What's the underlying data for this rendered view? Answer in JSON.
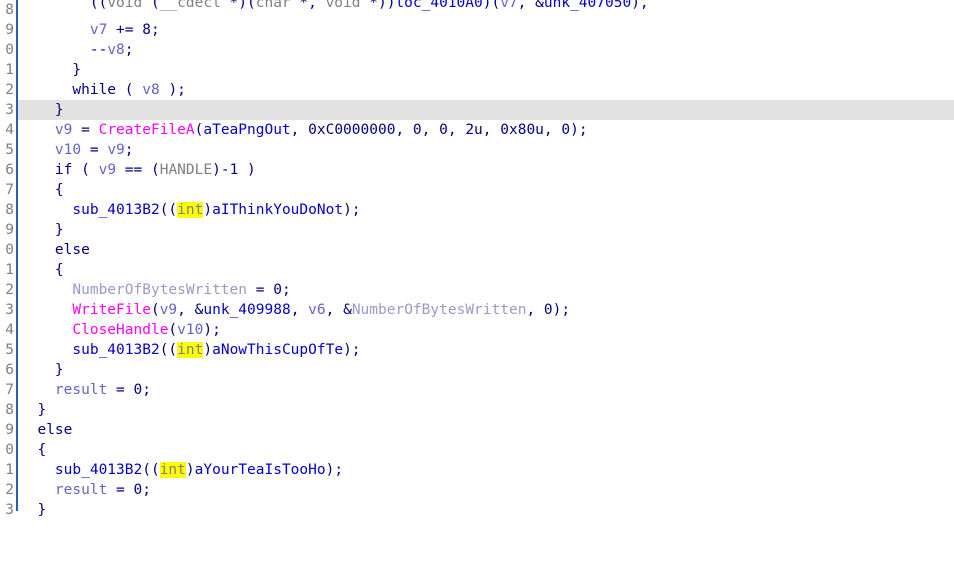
{
  "app": {
    "name": "IDA Pro Hex-Rays Pseudocode",
    "view": "Pseudocode-A"
  },
  "theme": {
    "background": "#ffffff",
    "gutter_border": "#2a5db0",
    "lineno_color": "#808080",
    "highlight_row": "#e2e2e2",
    "selection_highlight": "#ffff00",
    "plain": "#000080",
    "variable": "#6464c8",
    "library_function": "#ff00ff",
    "subroutine": "#0000cd",
    "type_name": "#808080",
    "dim_name": "#9a9ac8"
  },
  "editor": {
    "highlighted_line_index": 5,
    "selected_token": "int",
    "line_numbers": [
      "8",
      "9",
      "0",
      "1",
      "2",
      "3",
      "4",
      "5",
      "6",
      "7",
      "8",
      "9",
      "0",
      "1",
      "2",
      "3",
      "4",
      "5",
      "6",
      "7",
      "8",
      "9",
      "0",
      "1",
      "2",
      "3"
    ]
  },
  "code": {
    "lines": [
      {
        "n": "8",
        "text": "        ((void (__cdecl *)(char *, void *))loc_4010A0)(v7, &unk_407050),"
      },
      {
        "n": "9",
        "text": "        v7 += 8;"
      },
      {
        "n": "0",
        "text": "        --v8;"
      },
      {
        "n": "1",
        "text": "      }"
      },
      {
        "n": "2",
        "text": "      while ( v8 );"
      },
      {
        "n": "3",
        "text": "    }"
      },
      {
        "n": "4",
        "text": "    v9 = CreateFileA(aTeaPngOut, 0xC0000000, 0, 0, 2u, 0x80u, 0);"
      },
      {
        "n": "5",
        "text": "    v10 = v9;"
      },
      {
        "n": "6",
        "text": "    if ( v9 == (HANDLE)-1 )"
      },
      {
        "n": "7",
        "text": "    {"
      },
      {
        "n": "8",
        "text": "      sub_4013B2((int)aIThinkYouDoNot);"
      },
      {
        "n": "9",
        "text": "    }"
      },
      {
        "n": "0",
        "text": "    else"
      },
      {
        "n": "1",
        "text": "    {"
      },
      {
        "n": "2",
        "text": "      NumberOfBytesWritten = 0;"
      },
      {
        "n": "3",
        "text": "      WriteFile(v9, &unk_409988, v6, &NumberOfBytesWritten, 0);"
      },
      {
        "n": "4",
        "text": "      CloseHandle(v10);"
      },
      {
        "n": "5",
        "text": "      sub_4013B2((int)aNowThisCupOfTe);"
      },
      {
        "n": "6",
        "text": "    }"
      },
      {
        "n": "7",
        "text": "    result = 0;"
      },
      {
        "n": "8",
        "text": "  }"
      },
      {
        "n": "9",
        "text": "  else"
      },
      {
        "n": "0",
        "text": "  {"
      },
      {
        "n": "1",
        "text": "    sub_4013B2((int)aYourTeaIsTooHo);"
      },
      {
        "n": "2",
        "text": "    result = 0;"
      },
      {
        "n": "3",
        "text": "  }"
      }
    ],
    "identifiers": {
      "called_subroutines": [
        "loc_4010A0",
        "sub_4013B2"
      ],
      "api_functions": [
        "CreateFileA",
        "WriteFile",
        "CloseHandle"
      ],
      "string_refs": [
        "aTeaPngOut",
        "aIThinkYouDoNot",
        "aNowThisCupOfTe",
        "aYourTeaIsTooHo"
      ],
      "data_refs": [
        "unk_407050",
        "unk_409988"
      ],
      "locals": [
        "v6",
        "v7",
        "v8",
        "v9",
        "v10",
        "result",
        "NumberOfBytesWritten"
      ],
      "constants": [
        "0xC0000000",
        "2u",
        "0x80u",
        "0",
        "8",
        "-1"
      ]
    }
  }
}
